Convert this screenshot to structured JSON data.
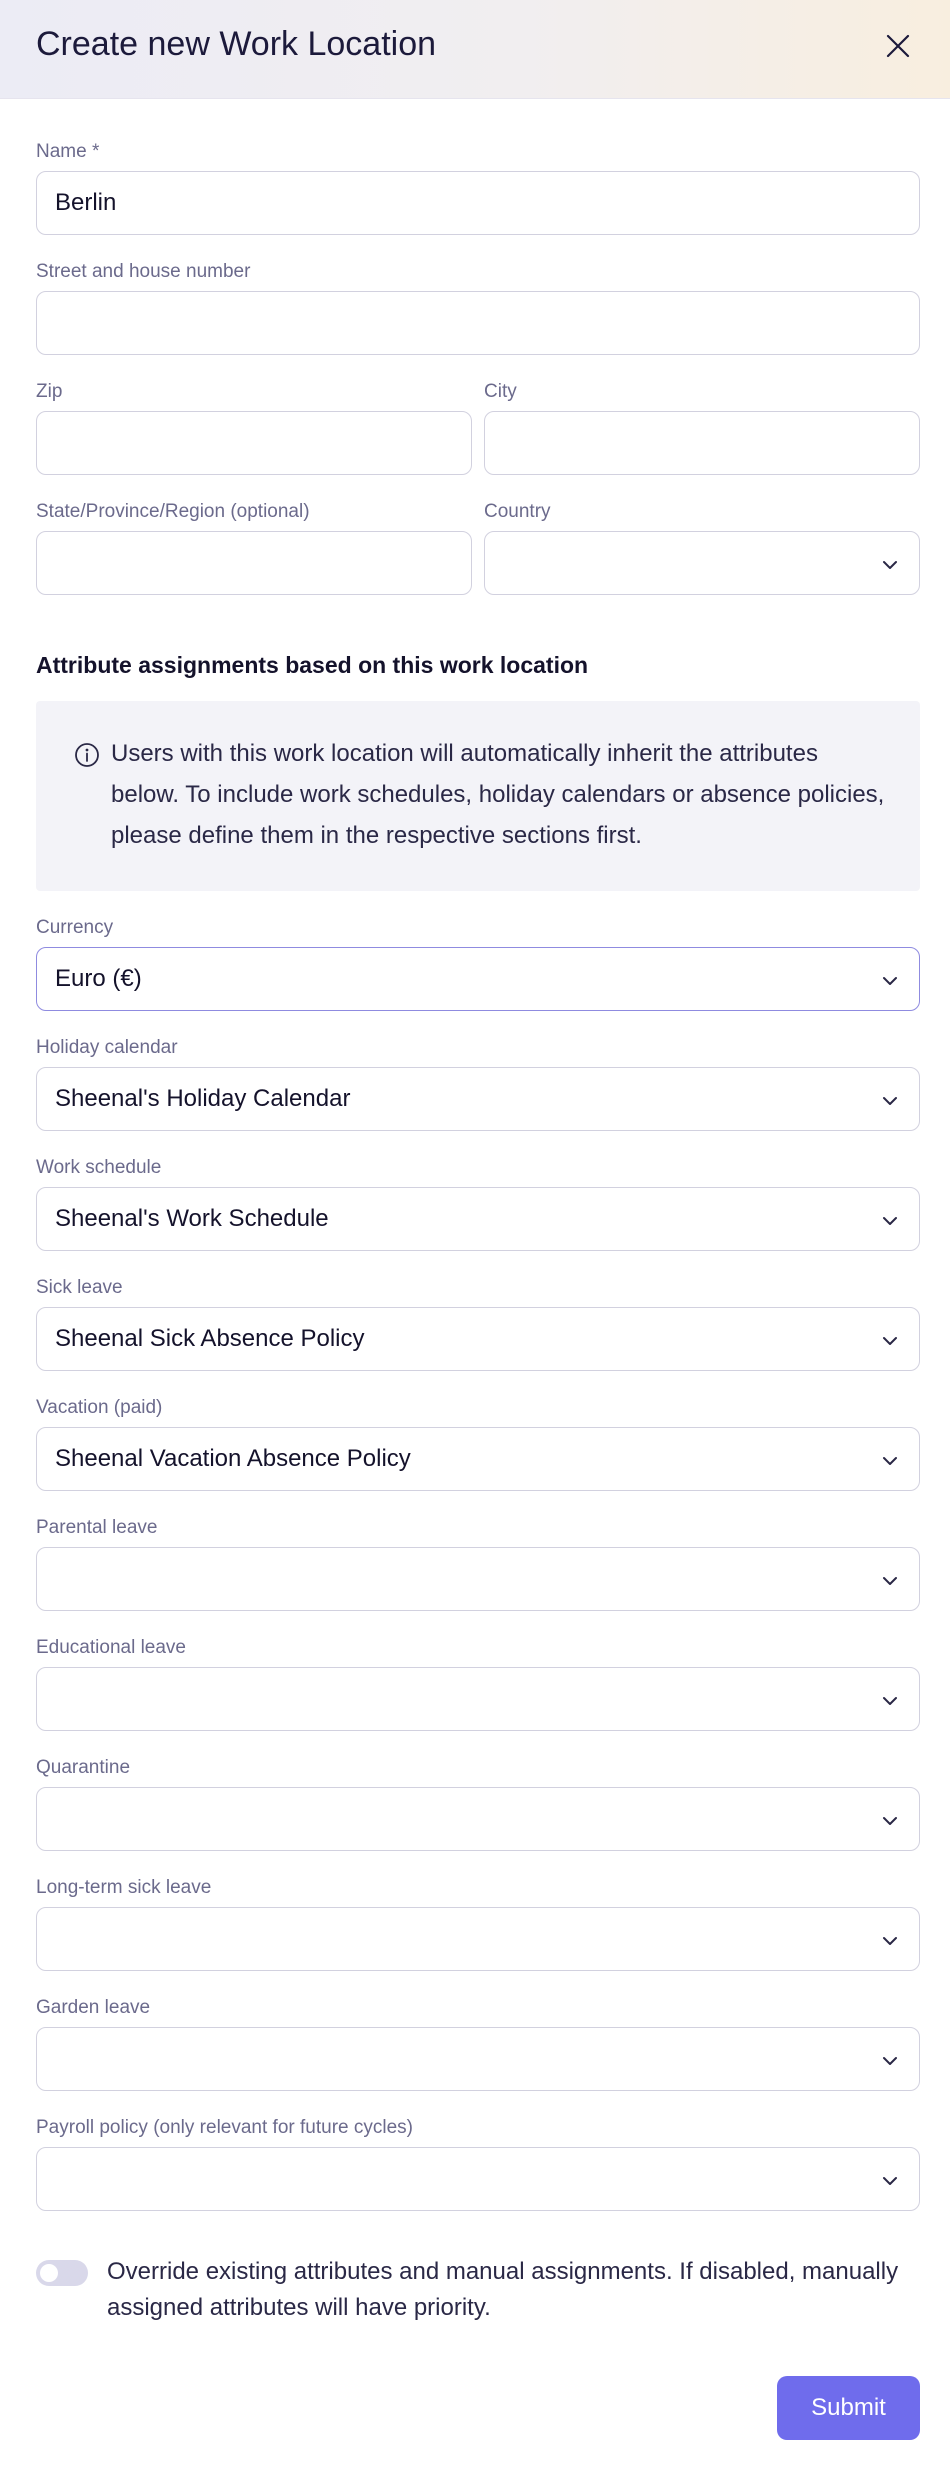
{
  "header": {
    "title": "Create new Work Location"
  },
  "form": {
    "name": {
      "label": "Name *",
      "value": "Berlin"
    },
    "street": {
      "label": "Street and house number",
      "value": ""
    },
    "zip": {
      "label": "Zip",
      "value": ""
    },
    "city": {
      "label": "City",
      "value": ""
    },
    "state": {
      "label": "State/Province/Region (optional)",
      "value": ""
    },
    "country": {
      "label": "Country",
      "value": ""
    }
  },
  "attributes": {
    "title": "Attribute assignments based on this work location",
    "info": "Users with this work location will automatically inherit the attributes below. To include work schedules, holiday calendars or absence policies, please define them in the respective sections first.",
    "fields": [
      {
        "label": "Currency",
        "value": "Euro (€)"
      },
      {
        "label": "Holiday calendar",
        "value": "Sheenal's Holiday Calendar"
      },
      {
        "label": "Work schedule",
        "value": "Sheenal's Work Schedule"
      },
      {
        "label": "Sick leave",
        "value": "Sheenal Sick Absence Policy"
      },
      {
        "label": "Vacation (paid)",
        "value": "Sheenal Vacation Absence Policy"
      },
      {
        "label": "Parental leave",
        "value": ""
      },
      {
        "label": "Educational leave",
        "value": ""
      },
      {
        "label": "Quarantine",
        "value": ""
      },
      {
        "label": "Long-term sick leave",
        "value": ""
      },
      {
        "label": "Garden leave",
        "value": ""
      },
      {
        "label": "Payroll policy (only relevant for future cycles)",
        "value": ""
      }
    ]
  },
  "override": {
    "enabled": false,
    "text": "Override existing attributes and manual assignments. If disabled, manually assigned attributes will have priority."
  },
  "actions": {
    "submit_label": "Submit"
  },
  "colors": {
    "accent": "#6f6cec",
    "label": "#6b6a8c",
    "border": "#d2d1df"
  }
}
